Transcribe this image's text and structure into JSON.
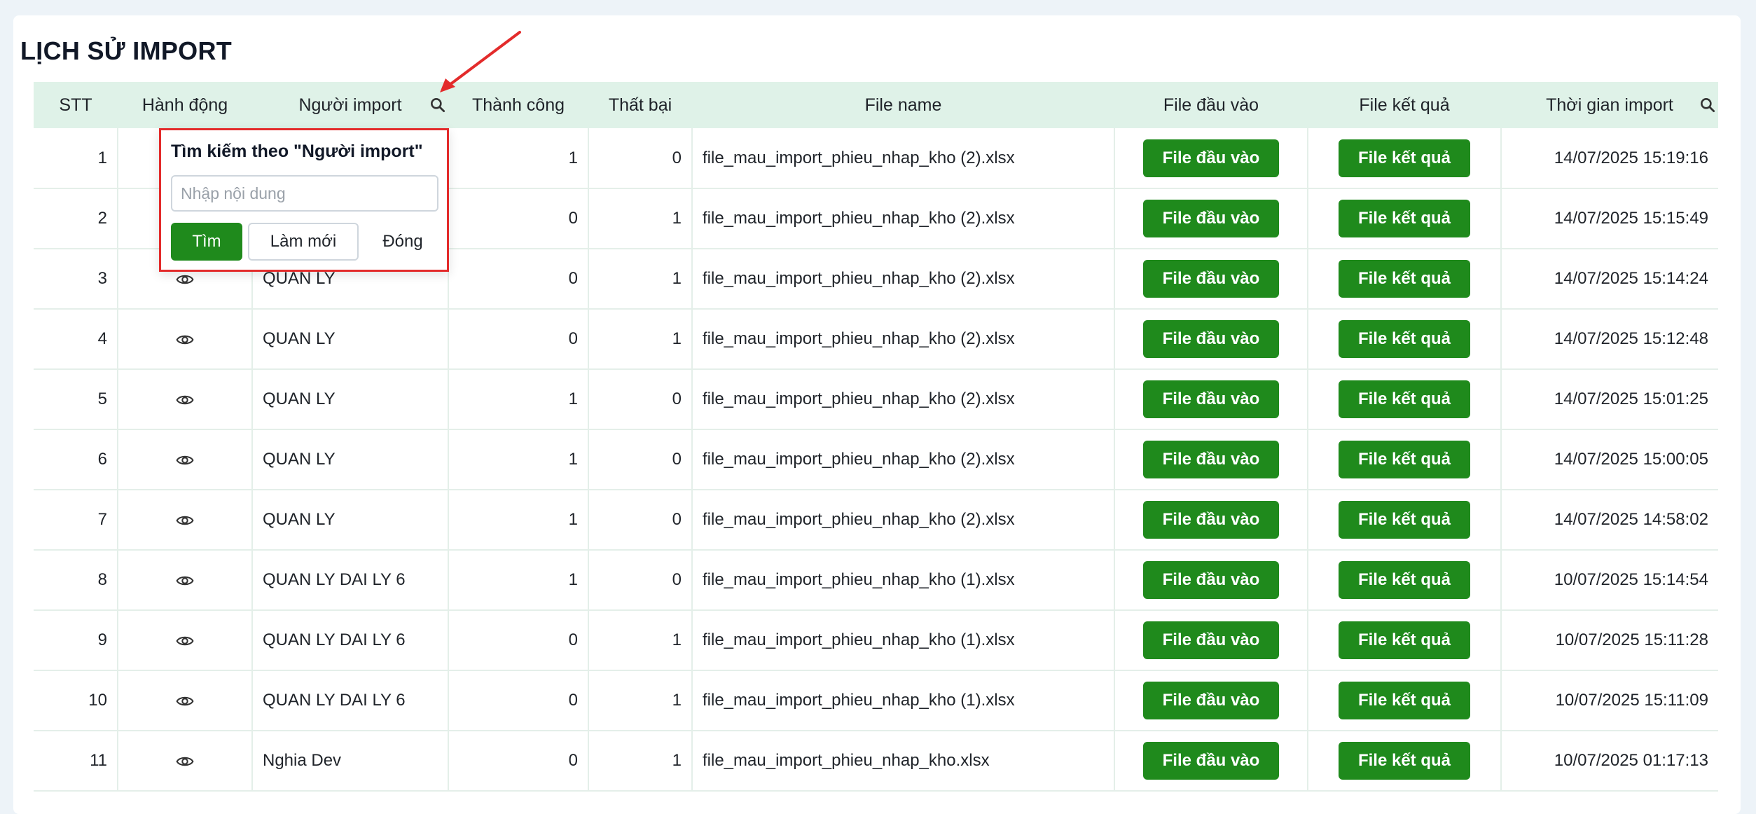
{
  "page": {
    "title": "LỊCH SỬ IMPORT"
  },
  "colors": {
    "accent_green": "#1f8a1c",
    "header_bg": "#dff2e8",
    "highlight_red": "#e32b2b"
  },
  "columns": {
    "stt": "STT",
    "action": "Hành động",
    "user": "Người import",
    "success": "Thành công",
    "failed": "Thất bại",
    "filename": "File name",
    "input_file": "File đầu vào",
    "result_file": "File kết quả",
    "time": "Thời gian import"
  },
  "popup": {
    "title": "Tìm kiếm theo \"Người import\"",
    "placeholder": "Nhập nội dung",
    "search_label": "Tìm",
    "reset_label": "Làm mới",
    "close_label": "Đóng"
  },
  "rows": [
    {
      "stt": "1",
      "user": "",
      "success": "1",
      "failed": "0",
      "filename": "file_mau_import_phieu_nhap_kho (2).xlsx",
      "input_btn": "File đầu vào",
      "result_btn": "File kết quả",
      "time": "14/07/2025 15:19:16"
    },
    {
      "stt": "2",
      "user": "",
      "success": "0",
      "failed": "1",
      "filename": "file_mau_import_phieu_nhap_kho (2).xlsx",
      "input_btn": "File đầu vào",
      "result_btn": "File kết quả",
      "time": "14/07/2025 15:15:49"
    },
    {
      "stt": "3",
      "user": "QUAN LY",
      "success": "0",
      "failed": "1",
      "filename": "file_mau_import_phieu_nhap_kho (2).xlsx",
      "input_btn": "File đầu vào",
      "result_btn": "File kết quả",
      "time": "14/07/2025 15:14:24"
    },
    {
      "stt": "4",
      "user": "QUAN LY",
      "success": "0",
      "failed": "1",
      "filename": "file_mau_import_phieu_nhap_kho (2).xlsx",
      "input_btn": "File đầu vào",
      "result_btn": "File kết quả",
      "time": "14/07/2025 15:12:48"
    },
    {
      "stt": "5",
      "user": "QUAN LY",
      "success": "1",
      "failed": "0",
      "filename": "file_mau_import_phieu_nhap_kho (2).xlsx",
      "input_btn": "File đầu vào",
      "result_btn": "File kết quả",
      "time": "14/07/2025 15:01:25"
    },
    {
      "stt": "6",
      "user": "QUAN LY",
      "success": "1",
      "failed": "0",
      "filename": "file_mau_import_phieu_nhap_kho (2).xlsx",
      "input_btn": "File đầu vào",
      "result_btn": "File kết quả",
      "time": "14/07/2025 15:00:05"
    },
    {
      "stt": "7",
      "user": "QUAN LY",
      "success": "1",
      "failed": "0",
      "filename": "file_mau_import_phieu_nhap_kho (2).xlsx",
      "input_btn": "File đầu vào",
      "result_btn": "File kết quả",
      "time": "14/07/2025 14:58:02"
    },
    {
      "stt": "8",
      "user": "QUAN LY DAI LY 6",
      "success": "1",
      "failed": "0",
      "filename": "file_mau_import_phieu_nhap_kho (1).xlsx",
      "input_btn": "File đầu vào",
      "result_btn": "File kết quả",
      "time": "10/07/2025 15:14:54"
    },
    {
      "stt": "9",
      "user": "QUAN LY DAI LY 6",
      "success": "0",
      "failed": "1",
      "filename": "file_mau_import_phieu_nhap_kho (1).xlsx",
      "input_btn": "File đầu vào",
      "result_btn": "File kết quả",
      "time": "10/07/2025 15:11:28"
    },
    {
      "stt": "10",
      "user": "QUAN LY DAI LY 6",
      "success": "0",
      "failed": "1",
      "filename": "file_mau_import_phieu_nhap_kho (1).xlsx",
      "input_btn": "File đầu vào",
      "result_btn": "File kết quả",
      "time": "10/07/2025 15:11:09"
    },
    {
      "stt": "11",
      "user": "Nghia Dev",
      "success": "0",
      "failed": "1",
      "filename": "file_mau_import_phieu_nhap_kho.xlsx",
      "input_btn": "File đầu vào",
      "result_btn": "File kết quả",
      "time": "10/07/2025 01:17:13"
    }
  ]
}
